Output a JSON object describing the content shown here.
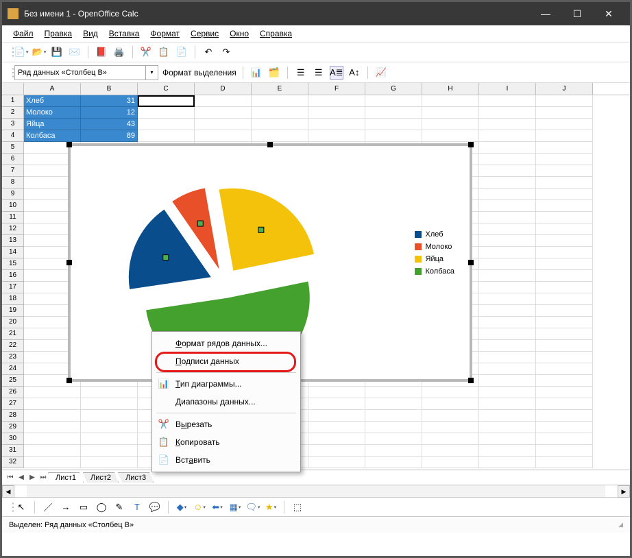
{
  "window": {
    "title": "Без имени 1 - OpenOffice Calc"
  },
  "menu": {
    "file": "Файл",
    "edit": "Правка",
    "view": "Вид",
    "insert": "Вставка",
    "format": "Формат",
    "tools": "Сервис",
    "window": "Окно",
    "help": "Справка"
  },
  "formula_bar": {
    "name_box": "Ряд данных «Столбец B»",
    "format_selection": "Формат выделения"
  },
  "columns": {
    "A": "A",
    "B": "B",
    "C": "C",
    "D": "D",
    "E": "E",
    "F": "F",
    "G": "G",
    "H": "H",
    "I": "I",
    "J": "J"
  },
  "rows": [
    "1",
    "2",
    "3",
    "4",
    "5",
    "6",
    "7",
    "8",
    "9",
    "10",
    "11",
    "12",
    "13",
    "14",
    "15",
    "16",
    "17",
    "18",
    "19",
    "20",
    "21",
    "22",
    "23",
    "24",
    "25",
    "26",
    "27",
    "28",
    "29",
    "30",
    "31",
    "32"
  ],
  "cells": {
    "A1": "Хлеб",
    "B1": "31",
    "A2": "Молоко",
    "B2": "12",
    "A3": "Яйца",
    "B3": "43",
    "A4": "Колбаса",
    "B4": "89"
  },
  "legend": {
    "item1": "Хлеб",
    "item2": "Молоко",
    "item3": "Яйца",
    "item4": "Колбаса"
  },
  "colors": {
    "series1": "#0a4d8c",
    "series2": "#e8502a",
    "series3": "#f4c20b",
    "series4": "#45a12e"
  },
  "context_menu": {
    "format_series": "Формат рядов данных...",
    "data_labels": "Подписи данных",
    "chart_type": "Тип диаграммы...",
    "data_ranges": "Диапазоны данных...",
    "cut": "Вырезать",
    "copy": "Копировать",
    "paste": "Вставить"
  },
  "sheet_tabs": {
    "sheet1": "Лист1",
    "sheet2": "Лист2",
    "sheet3": "Лист3"
  },
  "statusbar": {
    "text": "Выделен: Ряд данных «Столбец B»"
  },
  "chart_data": {
    "type": "pie",
    "categories": [
      "Хлеб",
      "Молоко",
      "Яйца",
      "Колбаса"
    ],
    "values": [
      31,
      12,
      43,
      89
    ],
    "series_name": "Столбец B",
    "colors": [
      "#0a4d8c",
      "#e8502a",
      "#f4c20b",
      "#45a12e"
    ],
    "legend_position": "right",
    "exploded": true,
    "title": ""
  }
}
